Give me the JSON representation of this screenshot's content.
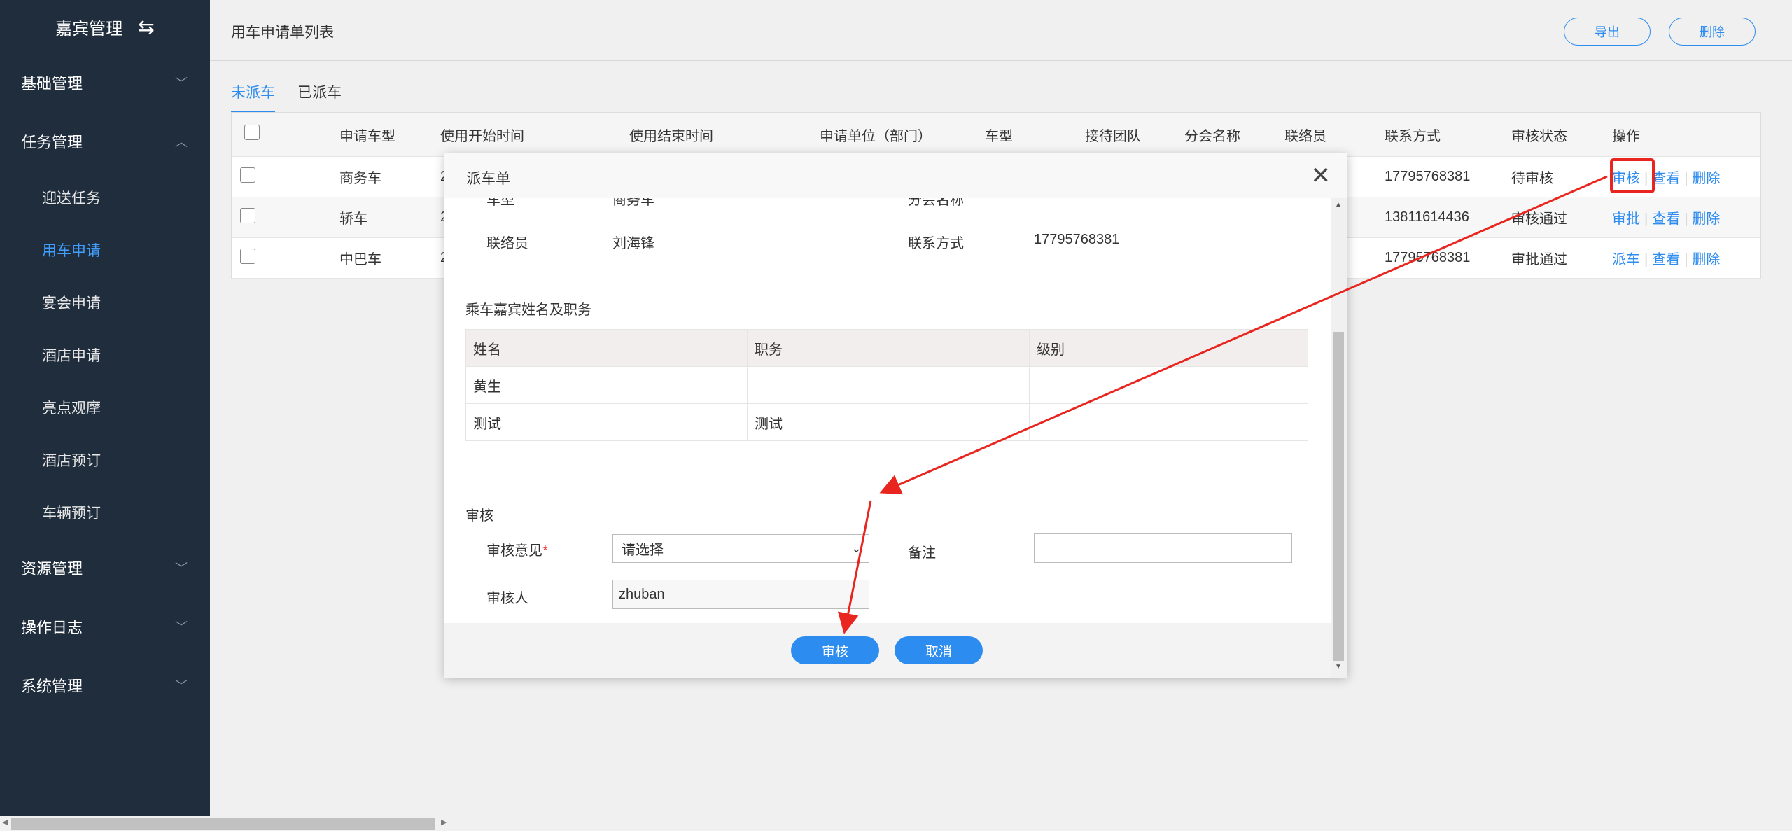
{
  "sidebar": {
    "title": "嘉宾管理",
    "swap_icon": "switch-icon",
    "groups": [
      {
        "label": "基础管理",
        "expanded": false
      },
      {
        "label": "任务管理",
        "expanded": true
      },
      {
        "label": "资源管理",
        "expanded": false
      },
      {
        "label": "操作日志",
        "expanded": false
      },
      {
        "label": "系统管理",
        "expanded": false
      }
    ],
    "task_items": [
      "迎送任务",
      "用车申请",
      "宴会申请",
      "酒店申请",
      "亮点观摩",
      "酒店预订",
      "车辆预订"
    ],
    "active_item": "用车申请"
  },
  "header": {
    "title": "用车申请单列表",
    "export_label": "导出",
    "delete_label": "删除"
  },
  "tabs": [
    "未派车",
    "已派车"
  ],
  "active_tab": "未派车",
  "table": {
    "headers": [
      "申请车型",
      "使用开始时间",
      "使用结束时间",
      "申请单位（部门）",
      "车型",
      "接待团队",
      "分会名称",
      "联络员",
      "联系方式",
      "审核状态",
      "操作"
    ],
    "rows": [
      {
        "type": "商务车",
        "start": "2",
        "phone": "17795768381",
        "status": "待审核",
        "actions": [
          "审核",
          "查看",
          "删除"
        ]
      },
      {
        "type": "轿车",
        "start": "2",
        "phone": "13811614436",
        "status": "审核通过",
        "actions": [
          "审批",
          "查看",
          "删除"
        ]
      },
      {
        "type": "中巴车",
        "start": "2",
        "phone": "17795768381",
        "status": "审批通过",
        "actions": [
          "派车",
          "查看",
          "删除"
        ]
      }
    ]
  },
  "dialog": {
    "title": "派车单",
    "partial_row": {
      "left_label": "车型",
      "left_value": "商务车",
      "right_label": "分会名称"
    },
    "contact_label": "联络员",
    "contact_value": "刘海锋",
    "phone_label": "联系方式",
    "phone_value": "17795768381",
    "guests_section": "乘车嘉宾姓名及职务",
    "guest_headers": [
      "姓名",
      "职务",
      "级别"
    ],
    "guests": [
      {
        "name": "黄生",
        "title": "",
        "level": ""
      },
      {
        "name": "测试",
        "title": "测试",
        "level": ""
      }
    ],
    "review_section": "审核",
    "opinion_label": "审核意见",
    "required_mark": "*",
    "opinion_placeholder": "请选择",
    "remark_label": "备注",
    "remark_value": "",
    "reviewer_label": "审核人",
    "reviewer_value": "zhuban",
    "submit_label": "审核",
    "cancel_label": "取消"
  },
  "annotation": {
    "highlight_color": "#e8251f",
    "arrow_color": "#e8251f"
  },
  "colors": {
    "sidebar_bg": "#1f2d3d",
    "accent": "#2d8cf0",
    "active_menu": "#409eff"
  }
}
